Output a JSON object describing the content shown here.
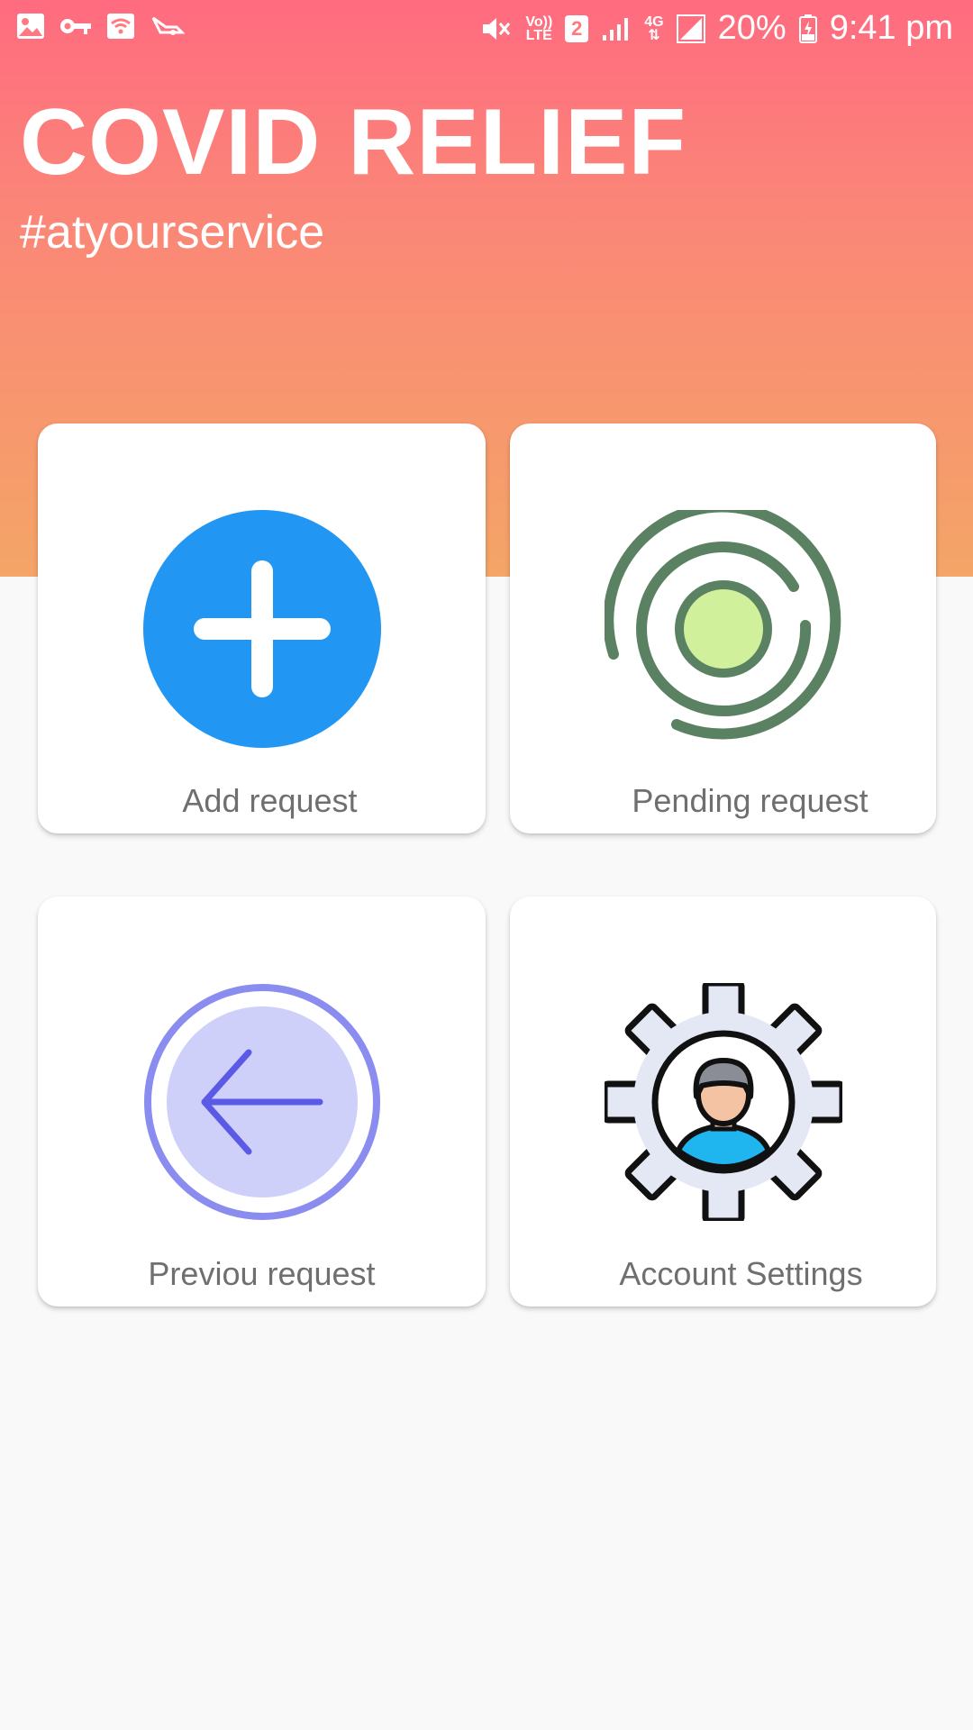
{
  "status_bar": {
    "battery": "20%",
    "time": "9:41 pm",
    "sim_slot": "2",
    "network_type": "4G",
    "volte_label_top": "Vo))",
    "volte_label_bottom": "LTE",
    "left_icons": [
      "gallery-icon",
      "key-icon",
      "wifi-icon",
      "app-notification-icon"
    ],
    "right_icons": [
      "mute-icon",
      "volte-icon",
      "sim-icon",
      "signal-icon",
      "4g-icon",
      "signal-icon",
      "battery-charging-icon"
    ]
  },
  "header": {
    "title": "COVID RELIEF",
    "subtitle": "#atyourservice"
  },
  "colors": {
    "header_gradient_top": "#ff6b80",
    "header_gradient_bottom": "#f4a567",
    "add_icon_blue": "#2196f3",
    "pending_icon_green": "#5a8262",
    "pending_icon_light": "#d0f09c",
    "previous_icon_ring": "#8a8cf0",
    "previous_icon_arrow": "#5a5ae6",
    "background": "#f9f9f9"
  },
  "menu": [
    {
      "id": "add",
      "label": "Add request",
      "icon": "add-circle-icon"
    },
    {
      "id": "pending",
      "label": "Pending request",
      "icon": "pending-target-icon"
    },
    {
      "id": "previous",
      "label": "Previou request",
      "icon": "back-arrow-circle-icon"
    },
    {
      "id": "settings",
      "label": "Account Settings",
      "icon": "gear-user-icon"
    }
  ]
}
